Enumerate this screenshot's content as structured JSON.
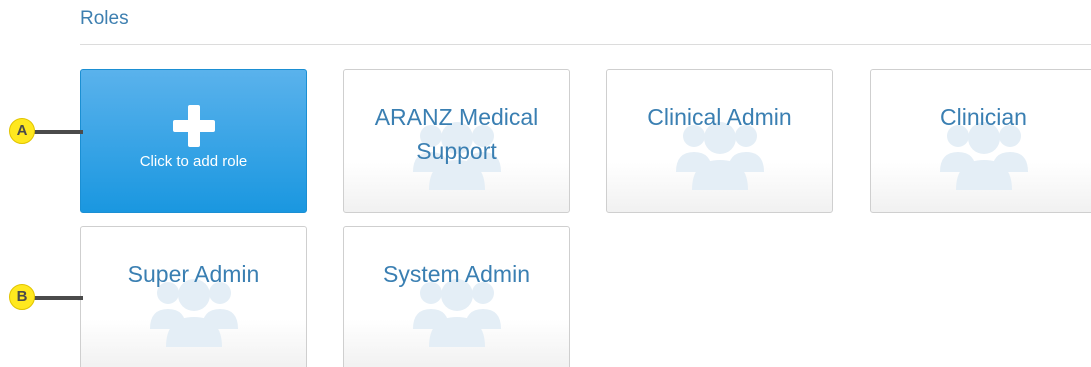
{
  "section": {
    "title": "Roles"
  },
  "add_card": {
    "label": "Click to add role",
    "icon": "plus-icon"
  },
  "roles": [
    {
      "label": "ARANZ Medical Support",
      "icon": "users-icon"
    },
    {
      "label": "Clinical Admin",
      "icon": "users-icon"
    },
    {
      "label": "Clinician",
      "icon": "users-icon"
    },
    {
      "label": "Super Admin",
      "icon": "users-icon"
    },
    {
      "label": "System Admin",
      "icon": "users-icon"
    }
  ],
  "callouts": [
    {
      "label": "A"
    },
    {
      "label": "B"
    }
  ],
  "colors": {
    "accent": "#1a97e0",
    "title_text": "#3d7fb0",
    "card_text": "#3a7fb2",
    "icon_fill": "#e4eef6",
    "callout_fill": "#ffe81f"
  }
}
